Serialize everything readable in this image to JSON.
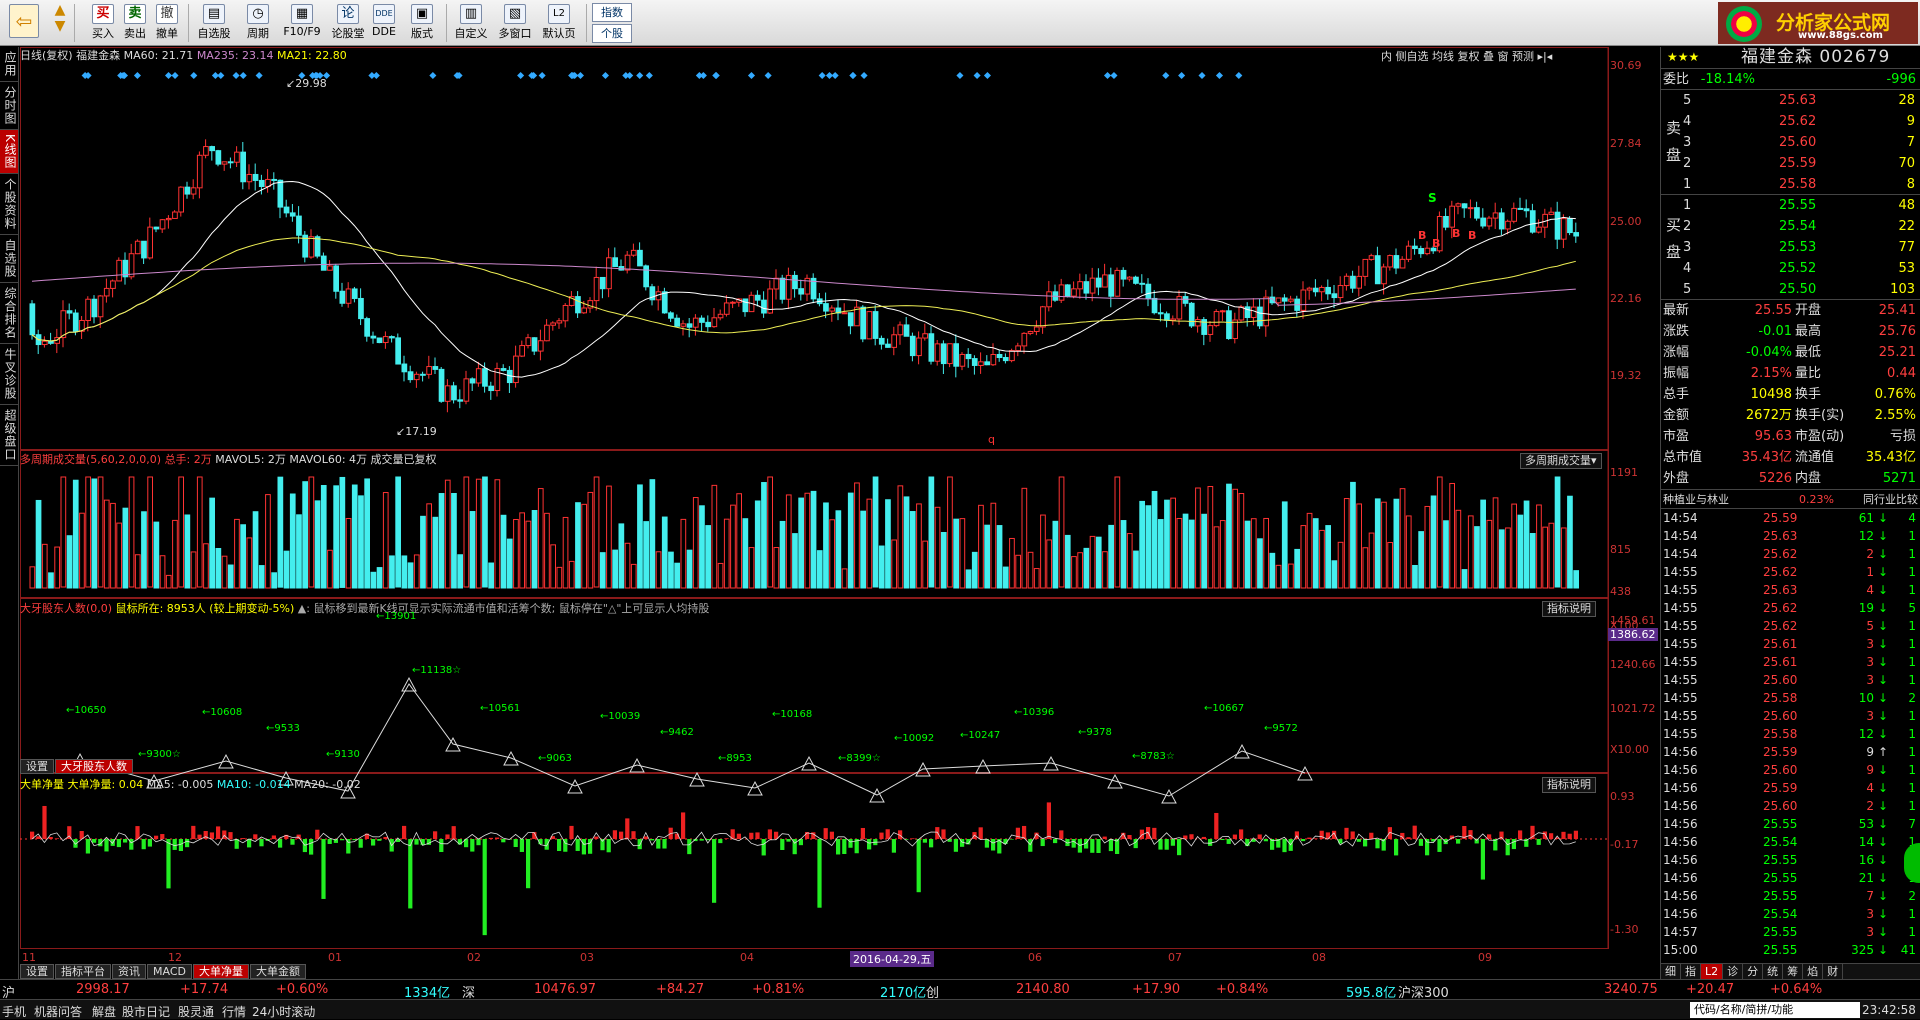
{
  "toolbar": {
    "items": [
      "买入",
      "卖出",
      "撤单",
      "自选股",
      "周期",
      "F10/F9",
      "论股堂",
      "DDE",
      "版式",
      "自定义",
      "多窗口",
      "默认页"
    ],
    "index_btn": "指数",
    "stock_btn": "个股",
    "logo_text": "分析家公式网",
    "logo_url": "www.88gs.com"
  },
  "leftnav": [
    "应用",
    "分时图",
    "K线图",
    "个股资料",
    "自选股",
    "综合排名",
    "牛叉诊股",
    "超级盘口"
  ],
  "price_panel": {
    "title": "日线(复权)",
    "name": "福建金森",
    "ma60": "MA60: 21.71",
    "ma235": "MA235: 23.14",
    "ma21": "MA21: 22.80",
    "high_label": "29.98",
    "low_label": "17.19",
    "axis": [
      "30.69",
      "27.84",
      "25.00",
      "22.16",
      "19.32"
    ],
    "top_buttons": [
      "内",
      "侧自选",
      "均线",
      "复权",
      "叠",
      "窗",
      "预测"
    ],
    "marks": [
      "S",
      "B",
      "B",
      "B",
      "B"
    ],
    "q_label": "q"
  },
  "volume_panel": {
    "title": "多周期成交量(5,60,2,0,0,0)",
    "total": "总手: 2万",
    "mavol5": "MAVOL5: 2万",
    "mavol60": "MAVOL60: 4万",
    "note": "成交量已复权",
    "btn": "多周期成交量▾",
    "axis": [
      "1191",
      "815",
      "438",
      "X100"
    ]
  },
  "holder_panel": {
    "title": "大牙股东人数(0,0)",
    "cursor": "鼠标所在: 8953人 (较上期变动-5%)",
    "hint": "▲: 鼠标移到最新K线可显示实际流通市值和活筹个数; 鼠标停在\"△\"上可显示人均持股",
    "btn": "指标说明",
    "axis": [
      "1459.61",
      "1386.62",
      "1240.66",
      "1021.72",
      "X10.00"
    ],
    "labels": [
      "10650",
      "9300☆",
      "10608",
      "9533",
      "9130",
      "13901",
      "11138☆",
      "10561",
      "9063",
      "10039",
      "9462",
      "8953",
      "10168",
      "8399☆",
      "10092",
      "10247",
      "10396",
      "9378",
      "8783☆",
      "10667",
      "9572"
    ],
    "tabs": [
      "设置",
      "大牙股东人数"
    ]
  },
  "bigorder_panel": {
    "title": "大单净量",
    "name": "大单净量:",
    "value": "0.04",
    "ma5": "MA5: -0.005",
    "ma10": "MA10: -0.014",
    "ma20": "MA20: -0.02",
    "btn": "指标说明",
    "axis": [
      "0.93",
      "-0.17",
      "-1.30"
    ]
  },
  "xaxis": {
    "months": [
      "11",
      "12",
      "01",
      "02",
      "03",
      "04",
      "06",
      "07",
      "08",
      "09"
    ],
    "cursor_date": "2016-04-29,五"
  },
  "bottom_tabs": [
    "设置",
    "指标平台",
    "资讯",
    "MACD",
    "大单净量",
    "大单金额"
  ],
  "right": {
    "header": "福建金森 002679",
    "stars": "★★★",
    "weibi_label": "委比",
    "weibi": "-18.14%",
    "weicha": "-996",
    "sell": [
      {
        "n": "5",
        "p": "25.63",
        "v": "28"
      },
      {
        "n": "4",
        "p": "25.62",
        "v": "9"
      },
      {
        "n": "3",
        "p": "25.60",
        "v": "7"
      },
      {
        "n": "2",
        "p": "25.59",
        "v": "70"
      },
      {
        "n": "1",
        "p": "25.58",
        "v": "8"
      }
    ],
    "buy": [
      {
        "n": "1",
        "p": "25.55",
        "v": "48"
      },
      {
        "n": "2",
        "p": "25.54",
        "v": "22"
      },
      {
        "n": "3",
        "p": "25.53",
        "v": "77"
      },
      {
        "n": "4",
        "p": "25.52",
        "v": "53"
      },
      {
        "n": "5",
        "p": "25.50",
        "v": "103"
      }
    ],
    "sell_label": "卖盘",
    "buy_label": "买盘",
    "stats": [
      [
        "最新",
        "25.55",
        "开盘",
        "25.41"
      ],
      [
        "涨跌",
        "-0.01",
        "最高",
        "25.76"
      ],
      [
        "涨幅",
        "-0.04%",
        "最低",
        "25.21"
      ],
      [
        "振幅",
        "2.15%",
        "量比",
        "0.44"
      ],
      [
        "总手",
        "10498",
        "换手",
        "0.76%"
      ],
      [
        "金额",
        "2672万",
        "换手(实)",
        "2.55%"
      ],
      [
        "市盈",
        "95.63",
        "市盈(动)",
        "亏损"
      ],
      [
        "总市值",
        "35.43亿",
        "流通值",
        "35.43亿"
      ],
      [
        "外盘",
        "5226",
        "内盘",
        "5271"
      ]
    ],
    "industry": "种植业与林业",
    "industry_pct": "0.23%",
    "industry_btn": "同行业比较",
    "ticks": [
      [
        "14:54",
        "25.59",
        "61",
        "↓",
        "4"
      ],
      [
        "14:54",
        "25.63",
        "12",
        "↓",
        "1"
      ],
      [
        "14:54",
        "25.62",
        "2",
        "↓",
        "1"
      ],
      [
        "14:55",
        "25.62",
        "1",
        "↓",
        "1"
      ],
      [
        "14:55",
        "25.63",
        "4",
        "↓",
        "1"
      ],
      [
        "14:55",
        "25.62",
        "19",
        "↓",
        "5"
      ],
      [
        "14:55",
        "25.62",
        "5",
        "↓",
        "1"
      ],
      [
        "14:55",
        "25.61",
        "3",
        "↓",
        "1"
      ],
      [
        "14:55",
        "25.61",
        "3",
        "↓",
        "1"
      ],
      [
        "14:55",
        "25.60",
        "3",
        "↓",
        "1"
      ],
      [
        "14:55",
        "25.58",
        "10",
        "↓",
        "2"
      ],
      [
        "14:55",
        "25.60",
        "3",
        "↓",
        "1"
      ],
      [
        "14:55",
        "25.58",
        "12",
        "↓",
        "1"
      ],
      [
        "14:56",
        "25.59",
        "9",
        "↑",
        "1"
      ],
      [
        "14:56",
        "25.60",
        "9",
        "↓",
        "1"
      ],
      [
        "14:56",
        "25.59",
        "4",
        "↓",
        "1"
      ],
      [
        "14:56",
        "25.60",
        "2",
        "↓",
        "1"
      ],
      [
        "14:56",
        "25.55",
        "53",
        "↓",
        "7"
      ],
      [
        "14:56",
        "25.54",
        "14",
        "↓",
        "1"
      ],
      [
        "14:56",
        "25.55",
        "16",
        "↓",
        "1"
      ],
      [
        "14:56",
        "25.55",
        "21",
        "↓",
        "1"
      ],
      [
        "14:56",
        "25.55",
        "7",
        "↓",
        "2"
      ],
      [
        "14:56",
        "25.54",
        "3",
        "↓",
        "1"
      ],
      [
        "14:57",
        "25.55",
        "3",
        "↓",
        "1"
      ],
      [
        "15:00",
        "25.55",
        "325",
        "↓",
        "41"
      ]
    ],
    "tabs": [
      "细",
      "指",
      "L2",
      "诊",
      "分",
      "统",
      "筹",
      "焰",
      "财"
    ]
  },
  "market": {
    "sh_label": "沪",
    "sh": "2998.17",
    "sh_chg": "+17.74",
    "sh_pct": "+0.60%",
    "sh_amt": "1334亿",
    "sz_label": "深",
    "sz": "10476.97",
    "sz_chg": "+84.27",
    "sz_pct": "+0.81%",
    "sz_amt": "2170亿",
    "cy_label": "创",
    "cy": "2140.80",
    "cy_chg": "+17.90",
    "cy_pct": "+0.84%",
    "cy_amt": "595.8亿",
    "hs_label": "沪深300",
    "hs": "3240.75",
    "hs_chg": "+20.47",
    "hs_pct": "+0.64%"
  },
  "status": {
    "items": [
      "手机",
      "机器问答",
      "解盘",
      "股市日记",
      "股灵通",
      "行情",
      "24小时滚动"
    ],
    "search": "代码/名称/简拼/功能",
    "time": "23:42:58"
  }
}
